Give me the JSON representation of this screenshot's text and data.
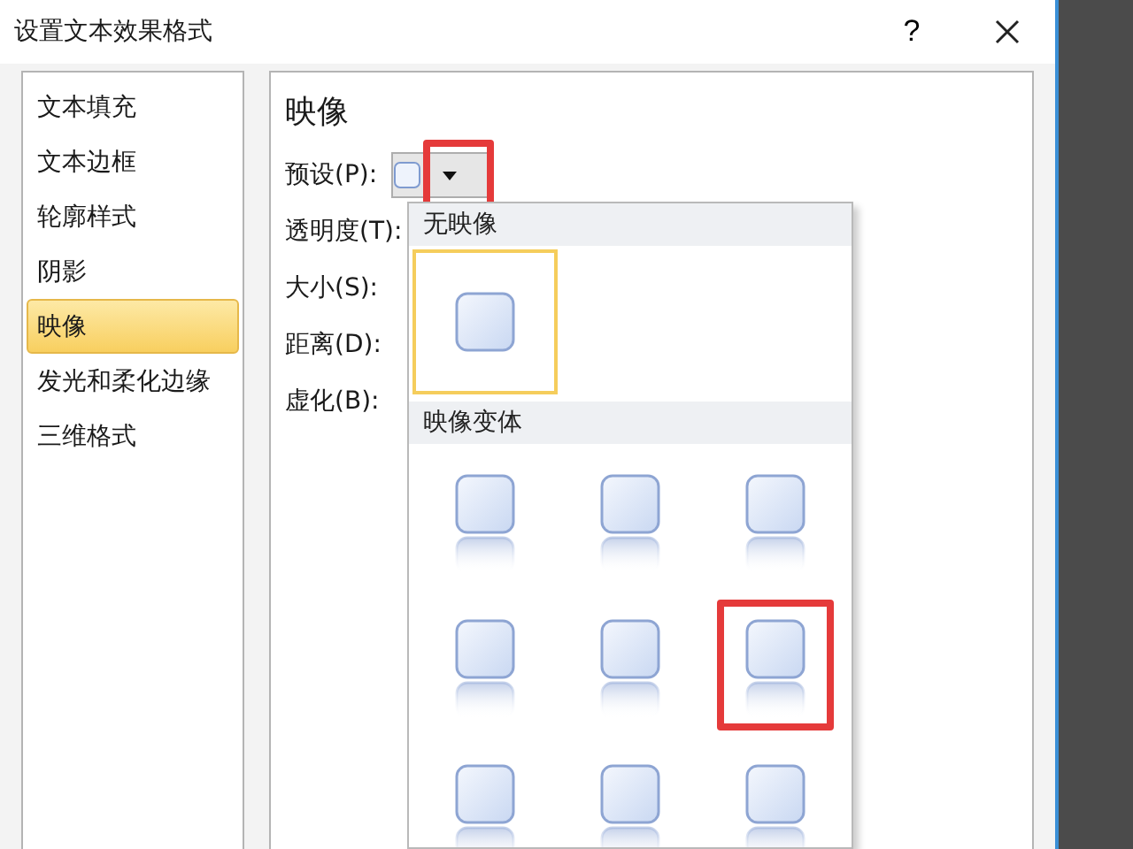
{
  "window": {
    "title": "设置文本效果格式",
    "help_label": "?"
  },
  "sidebar": {
    "items": [
      {
        "label": "文本填充",
        "selected": false
      },
      {
        "label": "文本边框",
        "selected": false
      },
      {
        "label": "轮廓样式",
        "selected": false
      },
      {
        "label": "阴影",
        "selected": false
      },
      {
        "label": "映像",
        "selected": true
      },
      {
        "label": "发光和柔化边缘",
        "selected": false
      },
      {
        "label": "三维格式",
        "selected": false
      }
    ]
  },
  "panel": {
    "title": "映像",
    "preset": {
      "label": "预设(P):",
      "annotated": true
    },
    "labels": [
      "透明度(T):",
      "大小(S):",
      "距离(D):",
      "虚化(B):"
    ]
  },
  "gallery": {
    "sections": [
      {
        "title": "无映像",
        "items": [
          {
            "kind": "none",
            "selected": true,
            "annotated": false
          }
        ]
      },
      {
        "title": "映像变体",
        "items": [
          {
            "kind": "reflection",
            "selected": false,
            "annotated": false
          },
          {
            "kind": "reflection",
            "selected": false,
            "annotated": false
          },
          {
            "kind": "reflection",
            "selected": false,
            "annotated": false
          },
          {
            "kind": "reflection",
            "selected": false,
            "annotated": false
          },
          {
            "kind": "reflection",
            "selected": false,
            "annotated": false
          },
          {
            "kind": "reflection",
            "selected": false,
            "annotated": true
          },
          {
            "kind": "reflection",
            "selected": false,
            "annotated": false
          },
          {
            "kind": "reflection",
            "selected": false,
            "annotated": false
          },
          {
            "kind": "reflection",
            "selected": false,
            "annotated": false
          }
        ]
      }
    ]
  }
}
